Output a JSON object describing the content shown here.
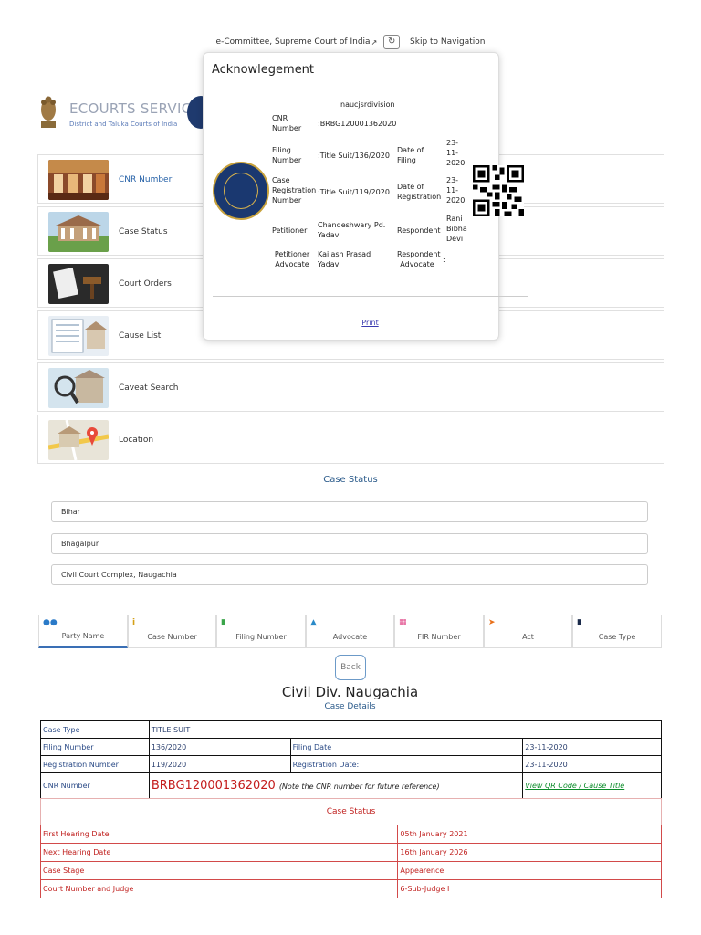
{
  "topbar": {
    "committee_text": "e-Committee, Supreme Court of India",
    "skip_text": "Skip to Navigation"
  },
  "header": {
    "brand": "ECOURTS SERVICES",
    "brand_sub": "District and Taluka Courts of India"
  },
  "menu": {
    "items": [
      {
        "label": "CNR Number",
        "icon": "courtroom-thumbnail"
      },
      {
        "label": "Case Status",
        "icon": "court-building-thumbnail"
      },
      {
        "label": "Court Orders",
        "icon": "gavel-thumbnail"
      },
      {
        "label": "Cause List",
        "icon": "list-thumbnail"
      },
      {
        "label": "Caveat Search",
        "icon": "magnifier-thumbnail"
      },
      {
        "label": "Location",
        "icon": "map-thumbnail"
      }
    ]
  },
  "case_status_form": {
    "title": "Case Status",
    "state": "Bihar",
    "district": "Bhagalpur",
    "complex": "Civil Court Complex, Naugachia"
  },
  "tabs": [
    {
      "label": "Party Name",
      "icon": "people-icon",
      "color": "#2a7ac8"
    },
    {
      "label": "Case Number",
      "icon": "info-icon",
      "color": "#d4a017"
    },
    {
      "label": "Filing Number",
      "icon": "copy-icon",
      "color": "#3aa54a"
    },
    {
      "label": "Advocate",
      "icon": "user-icon",
      "color": "#2a8ac8"
    },
    {
      "label": "FIR Number",
      "icon": "calendar-icon",
      "color": "#e04a8a"
    },
    {
      "label": "Act",
      "icon": "hammer-icon",
      "color": "#e8701a"
    },
    {
      "label": "Case Type",
      "icon": "document-icon",
      "color": "#1a2a4a"
    }
  ],
  "result": {
    "back_label": "Back",
    "court_name": "Civil Div. Naugachia",
    "details_title": "Case Details",
    "case_type_label": "Case Type",
    "case_type": "TITLE SUIT",
    "filing_number_label": "Filing Number",
    "filing_number": "136/2020",
    "filing_date_label": "Filing Date",
    "filing_date": "23-11-2020",
    "registration_number_label": "Registration Number",
    "registration_number": "119/2020",
    "registration_date_label": "Registration Date:",
    "registration_date": "23-11-2020",
    "cnr_label": "CNR Number",
    "cnr": "BRBG120001362020",
    "cnr_note": "(Note the CNR number for future reference)",
    "qr_link": "View QR Code / Cause Title",
    "status_title": "Case Status",
    "status_rows": [
      {
        "label": "First Hearing Date",
        "value": "05th January 2021"
      },
      {
        "label": "Next Hearing Date",
        "value": "16th January 2026"
      },
      {
        "label": "Case Stage",
        "value": "Appearence"
      },
      {
        "label": "Court Number and Judge",
        "value": "6-Sub-Judge I"
      }
    ]
  },
  "modal": {
    "title": "Acknowlegement",
    "heading": "naucjsrdivision",
    "cnr_label": "CNR Number",
    "cnr_value": ":BRBG120001362020",
    "filing_label": "Filing Number",
    "filing_value": ":Title Suit/136/2020",
    "date_filing_label": "Date of Filing",
    "date_filing_value": "23-11-2020",
    "reg_label": "Case Registration Number",
    "reg_value": ":Title Suit/119/2020",
    "date_reg_label": "Date of Registration",
    "date_reg_value": "23-11-2020",
    "petitioner_label": "Petitioner",
    "petitioner_value": "Chandeshwary Pd. Yadav",
    "respondent_label": "Respondent",
    "respondent_value": "Rani Bibha Devi",
    "pet_adv_label": "Petitioner Advocate",
    "pet_adv_value": "Kailash Prasad Yadav",
    "resp_adv_label": "Respondent Advocate",
    "resp_adv_value": ":",
    "print_label": "Print"
  }
}
